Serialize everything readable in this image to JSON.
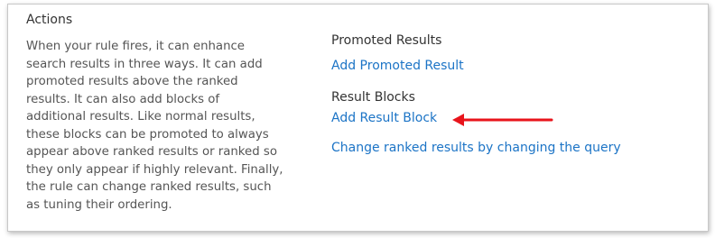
{
  "actions": {
    "title": "Actions",
    "description_lines": [
      "When your rule fires, it can enhance",
      "search results in three ways. It can add",
      "promoted results above the ranked",
      "results. It can also add blocks of",
      "additional results. Like normal results,",
      "these blocks can be promoted to always",
      "appear above ranked results or ranked so",
      "they only appear if highly relevant. Finally,",
      "the rule can change ranked results, such",
      "as tuning their ordering."
    ]
  },
  "promoted_results": {
    "label": "Promoted Results",
    "add_link": "Add Promoted Result"
  },
  "result_blocks": {
    "label": "Result Blocks",
    "add_link": "Add Result Block"
  },
  "change_query_link": "Change ranked results by changing the query",
  "colors": {
    "link": "#1c74c6",
    "annotation_arrow": "#e8141b"
  }
}
